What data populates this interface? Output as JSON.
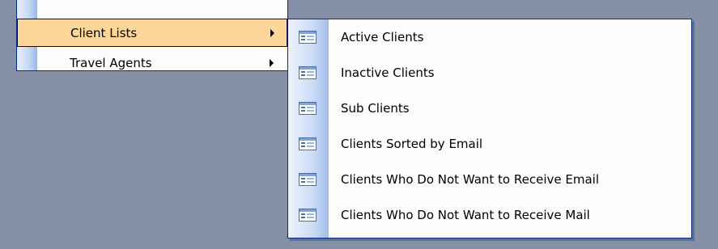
{
  "parent_menu": {
    "items": [
      {
        "label": "Client Lists",
        "highlighted": true,
        "has_submenu": true
      },
      {
        "label": "Travel Agents",
        "highlighted": false,
        "has_submenu": true
      }
    ]
  },
  "submenu": {
    "items": [
      {
        "label": "Active Clients",
        "icon": "form-icon"
      },
      {
        "label": "Inactive Clients",
        "icon": "form-icon"
      },
      {
        "label": "Sub Clients",
        "icon": "form-icon"
      },
      {
        "label": "Clients Sorted by Email",
        "icon": "form-icon"
      },
      {
        "label": "Clients Who Do Not Want to Receive Email",
        "icon": "form-icon"
      },
      {
        "label": "Clients Who Do Not Want to Receive Mail",
        "icon": "form-icon"
      }
    ]
  },
  "colors": {
    "background": "#8590a6",
    "menu_bg": "#fcfcfb",
    "highlight": "#fcd797",
    "border": "#002d96"
  }
}
